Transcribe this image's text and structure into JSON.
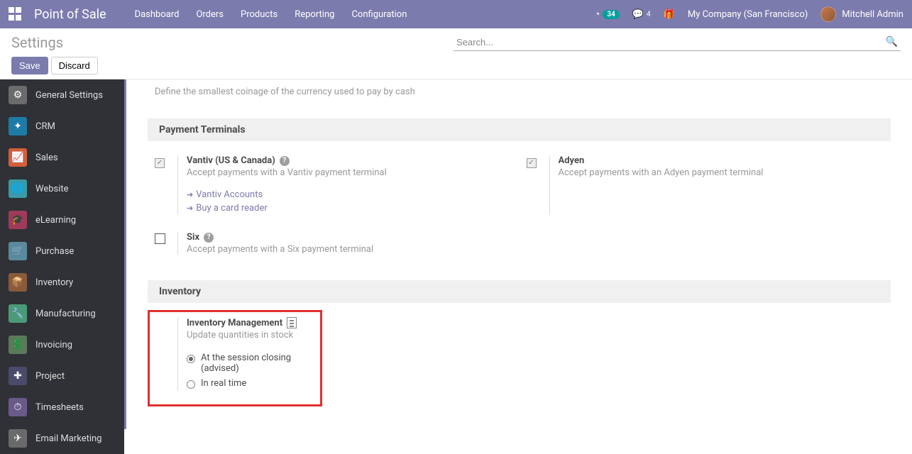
{
  "navbar": {
    "title": "Point of Sale",
    "menu": [
      "Dashboard",
      "Orders",
      "Products",
      "Reporting",
      "Configuration"
    ],
    "activity_badge": "34",
    "messages_badge": "4",
    "company": "My Company (San Francisco)",
    "user": "Mitchell Admin"
  },
  "control_panel": {
    "title": "Settings",
    "search_placeholder": "Search...",
    "save": "Save",
    "discard": "Discard"
  },
  "sidebar": {
    "items": [
      {
        "label": "General Settings",
        "color": "#6b6b6b"
      },
      {
        "label": "CRM",
        "color": "#1e7ba6"
      },
      {
        "label": "Sales",
        "color": "#d35f3a"
      },
      {
        "label": "Website",
        "color": "#3b9aa8"
      },
      {
        "label": "eLearning",
        "color": "#a03a5a"
      },
      {
        "label": "Purchase",
        "color": "#5a8a9e"
      },
      {
        "label": "Inventory",
        "color": "#8a5a3a"
      },
      {
        "label": "Manufacturing",
        "color": "#4a9a7a"
      },
      {
        "label": "Invoicing",
        "color": "#5a7a5a"
      },
      {
        "label": "Project",
        "color": "#4a4a6a"
      },
      {
        "label": "Timesheets",
        "color": "#6a5a8a"
      },
      {
        "label": "Email Marketing",
        "color": "#6a6a6a"
      }
    ]
  },
  "content": {
    "cash_rounding_desc": "Define the smallest coinage of the currency used to pay by cash",
    "sections": {
      "payment_terminals": {
        "title": "Payment Terminals",
        "vantiv": {
          "label": "Vantiv (US & Canada)",
          "desc": "Accept payments with a Vantiv payment terminal",
          "link1": "Vantiv Accounts",
          "link2": "Buy a card reader",
          "checked": true
        },
        "adyen": {
          "label": "Adyen",
          "desc": "Accept payments with an Adyen payment terminal",
          "checked": true
        },
        "six": {
          "label": "Six",
          "desc": "Accept payments with a Six payment terminal",
          "checked": false
        }
      },
      "inventory": {
        "title": "Inventory",
        "management": {
          "label": "Inventory Management",
          "desc": "Update quantities in stock",
          "opt1": "At the session closing (advised)",
          "opt2": "In real time"
        }
      }
    }
  }
}
